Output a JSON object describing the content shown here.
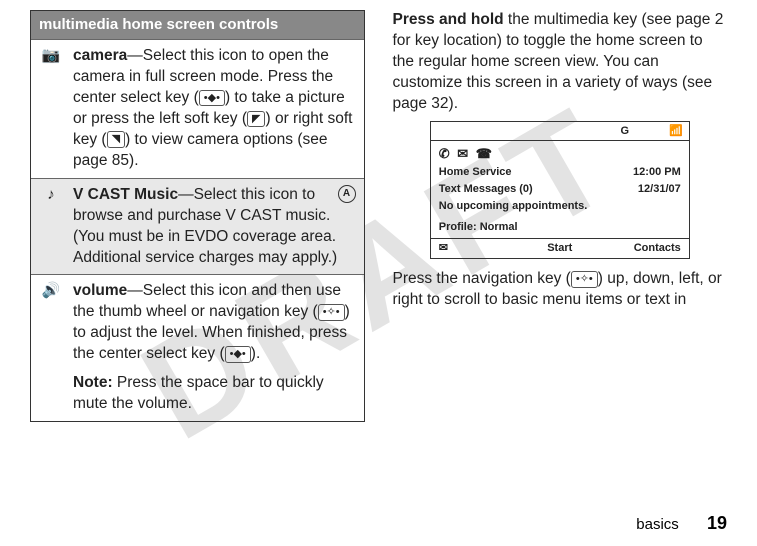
{
  "watermark": "DRAFT",
  "left": {
    "tableHeader": "multimedia home screen controls",
    "rows": [
      {
        "icon": "📷",
        "title": "camera",
        "body1": "—Select this icon to open the camera in full screen mode. Press the center select key (",
        "key1": "•◆•",
        "body2": ") to take a picture or press the left soft key (",
        "key2": "◤",
        "body3": ") or right soft key (",
        "key3": "◥",
        "body4": ") to view camera options (see page 85)."
      },
      {
        "icon": "♪",
        "title": "V CAST Music",
        "evdo": "A",
        "body1": "—Select this icon to browse and purchase V CAST music. (You must be in EVDO coverage area. Additional service charges may apply.)"
      },
      {
        "icon": "🔊",
        "title": "volume",
        "body1": "—Select this icon and then use the thumb wheel or navigation key (",
        "key1": "•✧•",
        "body2": ") to adjust the level. When finished, press the center select key (",
        "key2": "•◆•",
        "body3": ").",
        "noteLabel": "Note:",
        "noteBody": " Press the space bar to quickly mute the volume."
      }
    ]
  },
  "right": {
    "para1a": "Press and hold",
    "para1b": " the multimedia key (see page 2 for key location) to toggle the home screen to the regular home screen view. You can customize this screen in a variety of ways (see page 32).",
    "screen": {
      "topIcon1": "G",
      "topIcon2": "📶",
      "iconRow": "✆ ✉ ☎",
      "line1Left": "Home Service",
      "line1Right": "12:00 PM",
      "line2Left": "Text Messages (0)",
      "line2Right": "12/31/07",
      "line3": "No upcoming appointments.",
      "line4": "Profile: Normal",
      "softLeft": "✉",
      "softMid": "Start",
      "softRight": "Contacts"
    },
    "para2a": "Press the navigation key (",
    "para2key": "•✧•",
    "para2b": ") up, down, left, or right to scroll to basic menu items or text in"
  },
  "footer": {
    "section": "basics",
    "page": "19"
  }
}
